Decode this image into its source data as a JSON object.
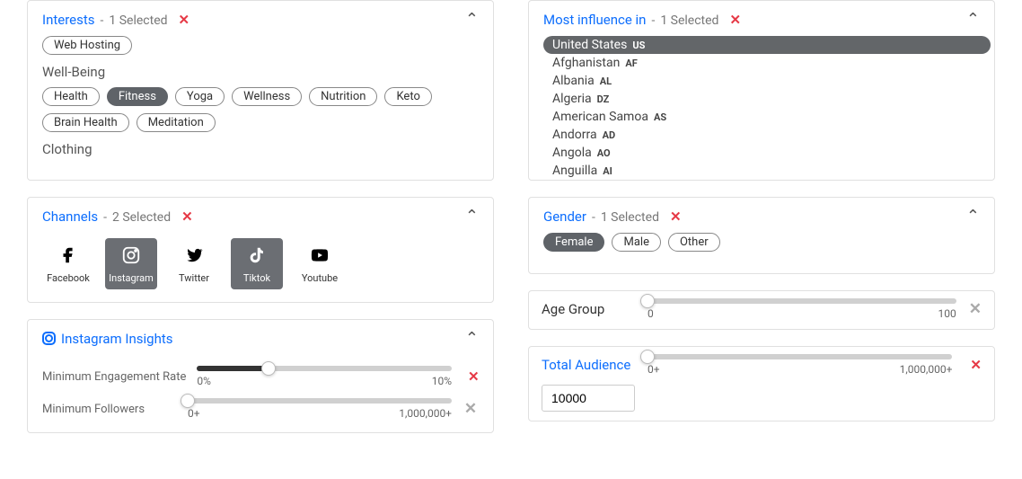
{
  "interests": {
    "title": "Interests",
    "sep": "-",
    "selected_text": "1 Selected",
    "top_tag": {
      "label": "Web Hosting",
      "selected": false
    },
    "groups": [
      {
        "name": "Well-Being",
        "tags": [
          {
            "label": "Health",
            "selected": false
          },
          {
            "label": "Fitness",
            "selected": true
          },
          {
            "label": "Yoga",
            "selected": false
          },
          {
            "label": "Wellness",
            "selected": false
          },
          {
            "label": "Nutrition",
            "selected": false
          },
          {
            "label": "Keto",
            "selected": false
          },
          {
            "label": "Brain Health",
            "selected": false
          },
          {
            "label": "Meditation",
            "selected": false
          }
        ]
      },
      {
        "name": "Clothing",
        "tags": []
      }
    ]
  },
  "channels": {
    "title": "Channels",
    "sep": "-",
    "selected_text": "2 Selected",
    "items": [
      {
        "label": "Facebook",
        "icon": "facebook-icon",
        "selected": false
      },
      {
        "label": "Instagram",
        "icon": "instagram-icon",
        "selected": true
      },
      {
        "label": "Twitter",
        "icon": "twitter-icon",
        "selected": false
      },
      {
        "label": "Tiktok",
        "icon": "tiktok-icon",
        "selected": true
      },
      {
        "label": "Youtube",
        "icon": "youtube-icon",
        "selected": false
      }
    ]
  },
  "insights": {
    "title": "Instagram Insights",
    "engagement": {
      "label": "Minimum Engagement Rate",
      "min": "0%",
      "max": "10%",
      "fill_pct": 28
    },
    "followers": {
      "label": "Minimum Followers",
      "min": "0+",
      "max": "1,000,000+",
      "fill_pct": 0
    }
  },
  "influence": {
    "title": "Most influence in",
    "sep": "-",
    "selected_text": "1 Selected",
    "countries": [
      {
        "name": "United States",
        "code": "US",
        "selected": true
      },
      {
        "name": "Afghanistan",
        "code": "AF",
        "selected": false
      },
      {
        "name": "Albania",
        "code": "AL",
        "selected": false
      },
      {
        "name": "Algeria",
        "code": "DZ",
        "selected": false
      },
      {
        "name": "American Samoa",
        "code": "AS",
        "selected": false
      },
      {
        "name": "Andorra",
        "code": "AD",
        "selected": false
      },
      {
        "name": "Angola",
        "code": "AO",
        "selected": false
      },
      {
        "name": "Anguilla",
        "code": "AI",
        "selected": false
      }
    ]
  },
  "gender": {
    "title": "Gender",
    "sep": "-",
    "selected_text": "1 Selected",
    "options": [
      {
        "label": "Female",
        "selected": true
      },
      {
        "label": "Male",
        "selected": false
      },
      {
        "label": "Other",
        "selected": false
      }
    ]
  },
  "age_group": {
    "title": "Age Group",
    "min": "0",
    "max": "100",
    "fill_pct": 0
  },
  "audience": {
    "title": "Total Audience",
    "min": "0+",
    "max": "1,000,000+",
    "fill_pct": 0,
    "value": "10000"
  }
}
